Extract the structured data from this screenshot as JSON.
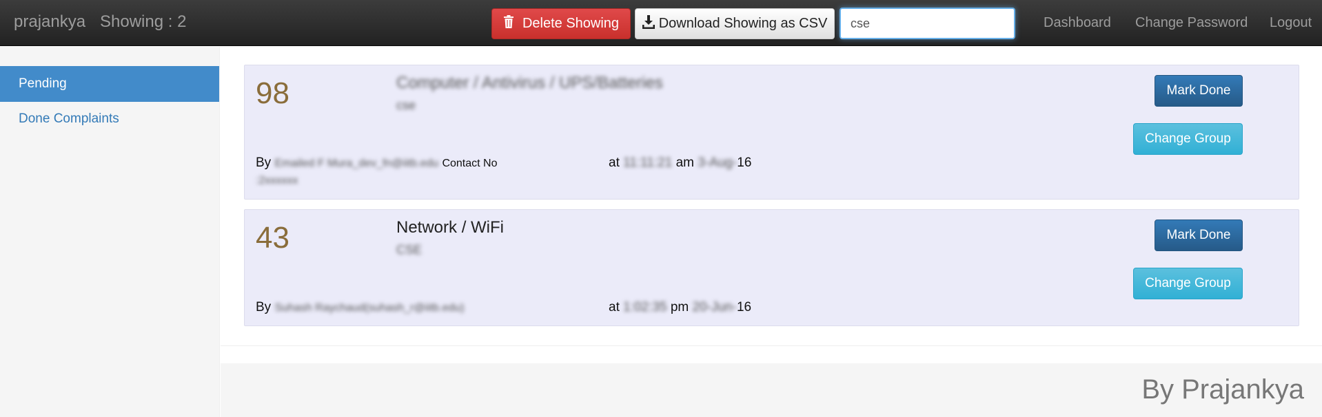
{
  "navbar": {
    "brand": "prajankya",
    "showing": "Showing : 2",
    "delete_label": "Delete Showing",
    "csv_label": "Download Showing as CSV",
    "search_value": "cse",
    "links": [
      "Dashboard",
      "Change Password",
      "Logout"
    ],
    "delete_icon": "trash-icon",
    "csv_icon": "download-icon"
  },
  "sidebar": {
    "items": [
      "Pending",
      "Done Complaints"
    ]
  },
  "complaints": [
    {
      "number": "98",
      "category": "Computer / Antivirus / UPS/Batteries",
      "group": "cse",
      "by_prefix": "By",
      "by_name": "Emailed F Mura_dev_fn@iitb.edu",
      "contact_label": "Contact No",
      "contact_value": ":2xxxxxx",
      "at_label": "at",
      "time": "11:11:21",
      "ampm": "am",
      "date": "3-Aug-",
      "year": "16",
      "mark_done": "Mark Done",
      "change_group": "Change Group"
    },
    {
      "number": "43",
      "category": "Network / WiFi",
      "group": "CSE",
      "by_prefix": "By",
      "by_name": "Suhash Raychaud(suhash_r@iitb.edu)",
      "at_label": "at",
      "time": "1:02:35",
      "ampm": "pm",
      "date": "20-Jun-",
      "year": "16",
      "mark_done": "Mark Done",
      "change_group": "Change Group"
    }
  ],
  "footer": {
    "text": "By Prajankya"
  }
}
